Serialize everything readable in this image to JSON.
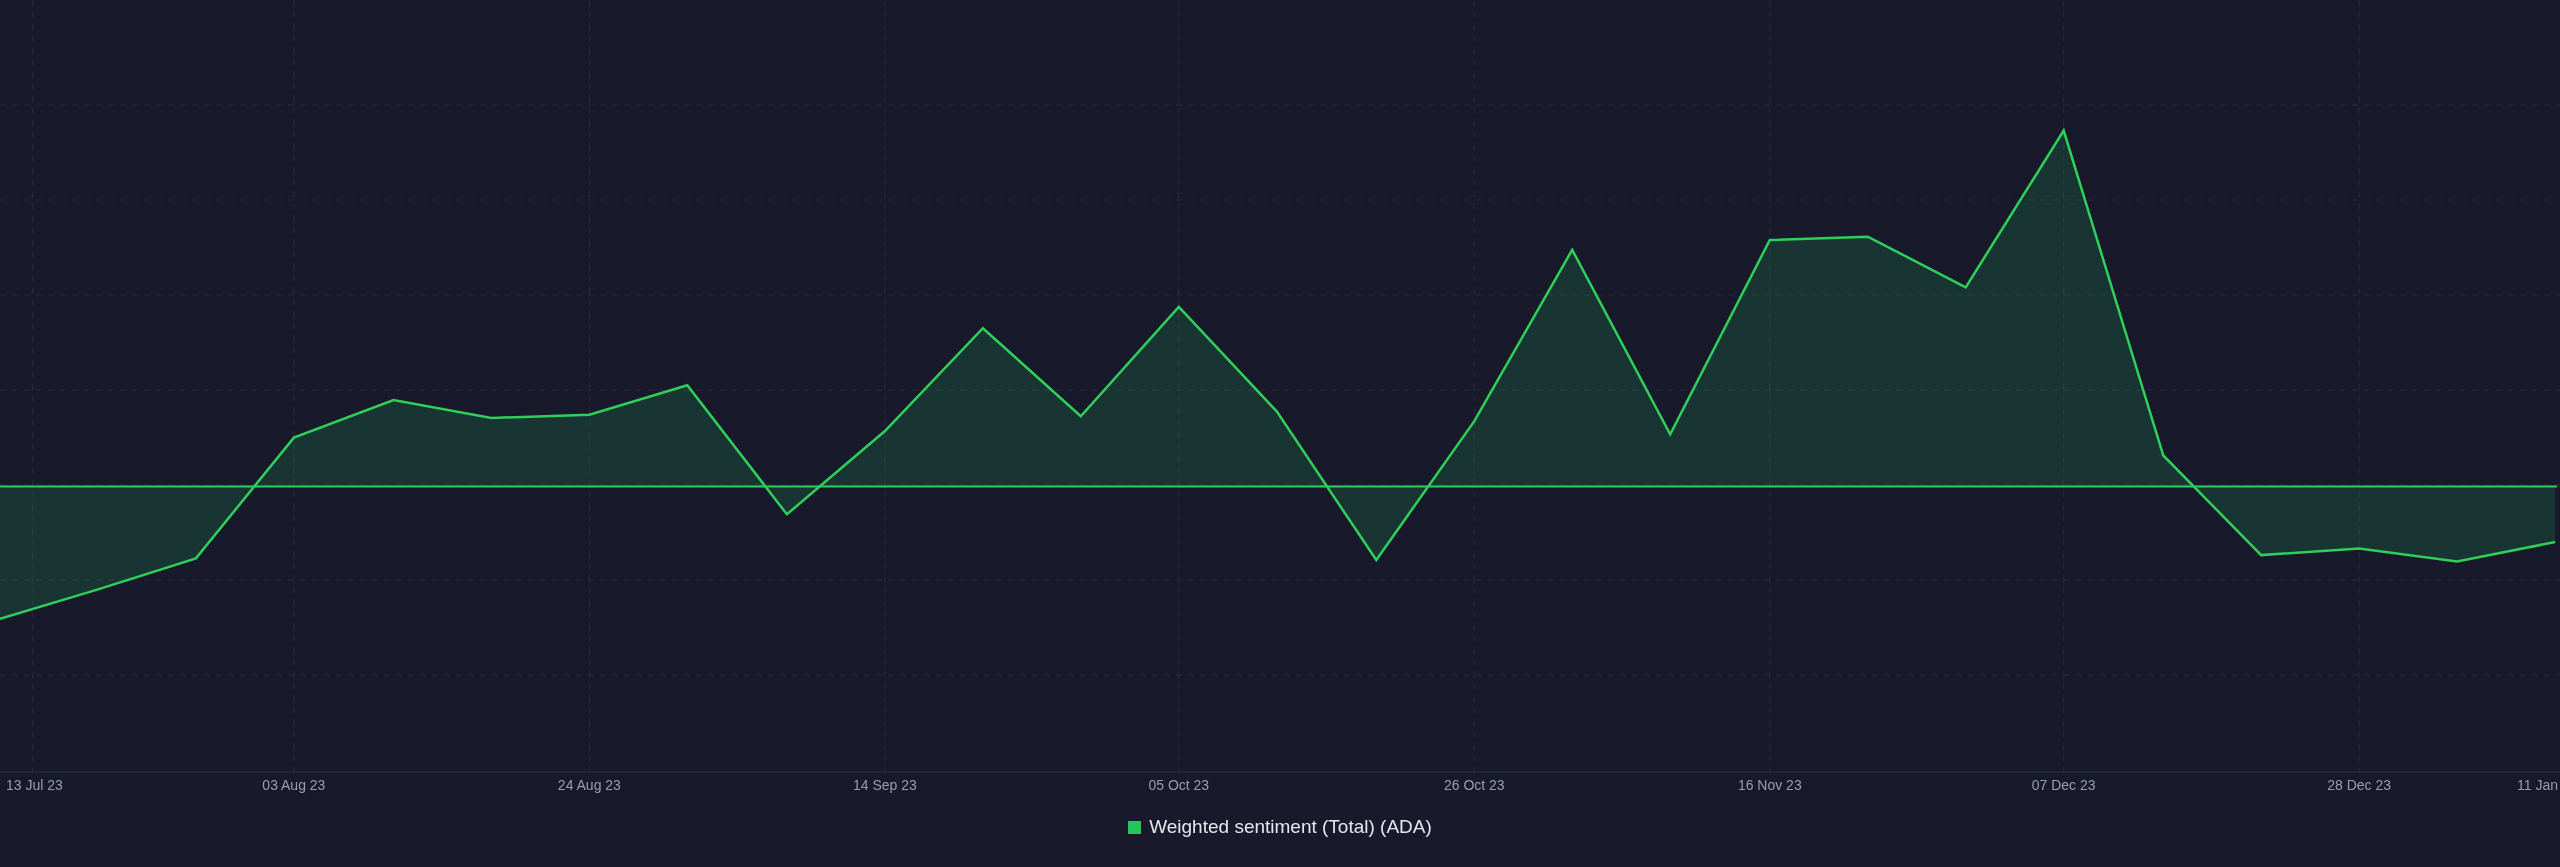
{
  "chart": {
    "x_labels": [
      "13 Jul 23",
      "03 Aug 23",
      "24 Aug 23",
      "14 Sep 23",
      "05 Oct 23",
      "26 Oct 23",
      "16 Nov 23",
      "07 Dec 23",
      "28 Dec 23",
      "11 Jan"
    ]
  },
  "legend": {
    "label": "Weighted sentiment (Total) (ADA)"
  }
}
